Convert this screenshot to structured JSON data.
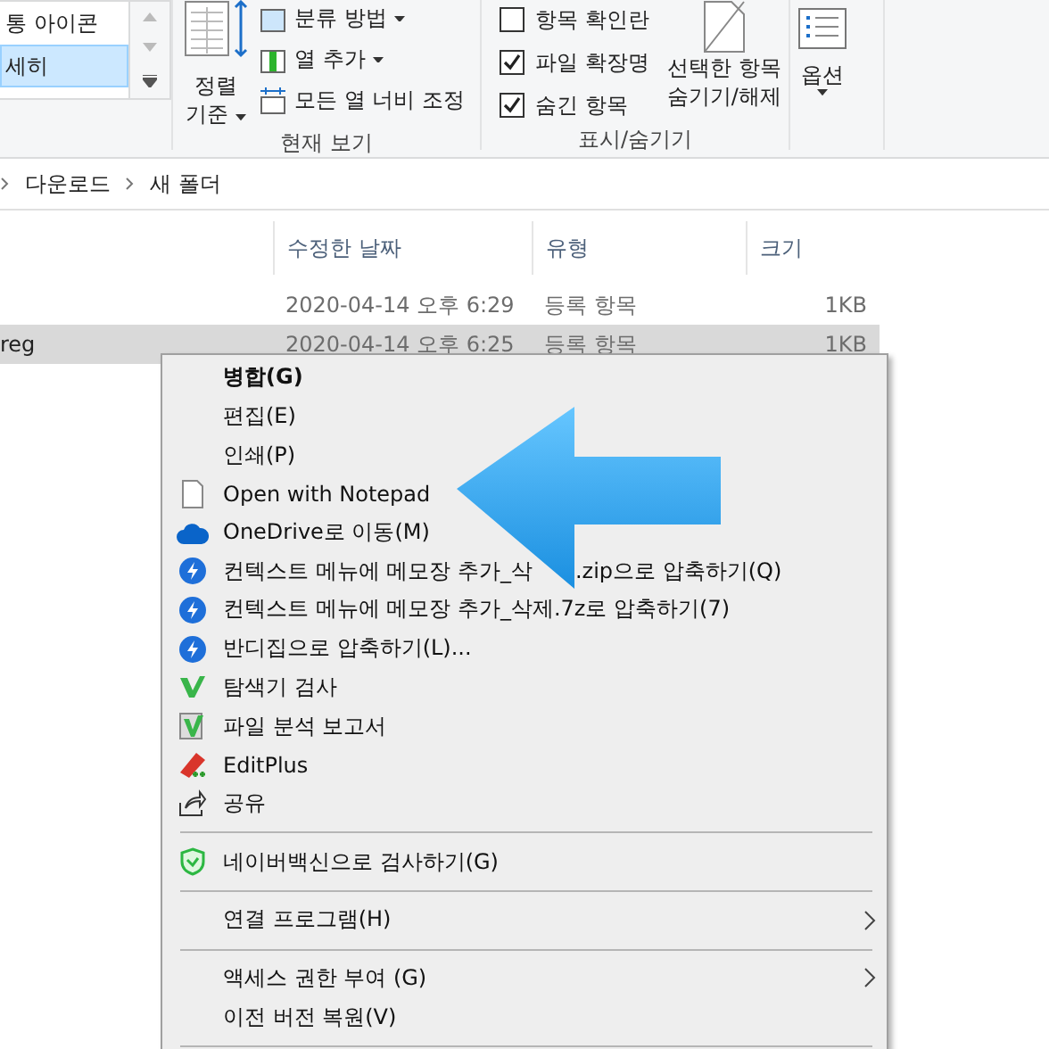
{
  "ribbon": {
    "layout_list": [
      {
        "label": "통 아이콘",
        "selected": false
      },
      {
        "label": "세히",
        "selected": true
      }
    ],
    "current_view": {
      "sort_button": [
        "정렬",
        "기준"
      ],
      "commands": [
        {
          "label": "분류 방법",
          "dropdown": true
        },
        {
          "label": "열 추가",
          "dropdown": true
        },
        {
          "label": "모든 열 너비 조정",
          "dropdown": false
        }
      ],
      "group_label": "현재 보기"
    },
    "show_hide": {
      "checkboxes": [
        {
          "label": "항목 확인란",
          "checked": false
        },
        {
          "label": "파일 확장명",
          "checked": true
        },
        {
          "label": "숨긴 항목",
          "checked": true
        }
      ],
      "hide_button": [
        "선택한 항목",
        "숨기기/해제"
      ],
      "group_label": "표시/숨기기"
    },
    "options_button": "옵션"
  },
  "breadcrumb": [
    "다운로드",
    "새 폴더"
  ],
  "columns": [
    "수정한 날짜",
    "유형",
    "크기"
  ],
  "rows": [
    {
      "name": "",
      "date": "2020-04-14 오후 6:29",
      "type": "등록 항목",
      "size": "1KB",
      "selected": false
    },
    {
      "name": "reg",
      "date": "2020-04-14 오후 6:25",
      "type": "등록 항목",
      "size": "1KB",
      "selected": true
    }
  ],
  "context_menu": [
    {
      "kind": "item",
      "label": "병합(G)",
      "default": true,
      "submenu": false
    },
    {
      "kind": "item",
      "label": "편집(E)",
      "default": false,
      "submenu": false
    },
    {
      "kind": "item",
      "label": "인쇄(P)",
      "default": false,
      "submenu": false
    },
    {
      "kind": "item",
      "label": "Open with Notepad",
      "default": false,
      "submenu": false
    },
    {
      "kind": "item",
      "label": "OneDrive로 이동(M)",
      "default": false,
      "submenu": false
    },
    {
      "kind": "covered",
      "label_parts": [
        "컨텍스트 메뉴에 메모장 추가_삭",
        ".zip으로 압축하기(Q)"
      ],
      "default": false,
      "submenu": false
    },
    {
      "kind": "item",
      "label": "컨텍스트 메뉴에 메모장 추가_삭제.7z로 압축하기(7)",
      "default": false,
      "submenu": false
    },
    {
      "kind": "item",
      "label": "반디집으로 압축하기(L)...",
      "default": false,
      "submenu": false
    },
    {
      "kind": "item",
      "label": "탐색기 검사",
      "default": false,
      "submenu": false
    },
    {
      "kind": "item",
      "label": "파일 분석 보고서",
      "default": false,
      "submenu": false
    },
    {
      "kind": "item",
      "label": "EditPlus",
      "default": false,
      "submenu": false
    },
    {
      "kind": "item",
      "label": "공유",
      "default": false,
      "submenu": false
    },
    {
      "kind": "separator"
    },
    {
      "kind": "item",
      "label": "네이버백신으로 검사하기(G)",
      "default": false,
      "submenu": false
    },
    {
      "kind": "separator"
    },
    {
      "kind": "item",
      "label": "연결 프로그램(H)",
      "default": false,
      "submenu": true
    },
    {
      "kind": "separator"
    },
    {
      "kind": "item",
      "label": "액세스 권한 부여 (G)",
      "default": false,
      "submenu": true
    },
    {
      "kind": "item",
      "label": "이전 버전 복원(V)",
      "default": false,
      "submenu": false
    },
    {
      "kind": "separator"
    }
  ]
}
